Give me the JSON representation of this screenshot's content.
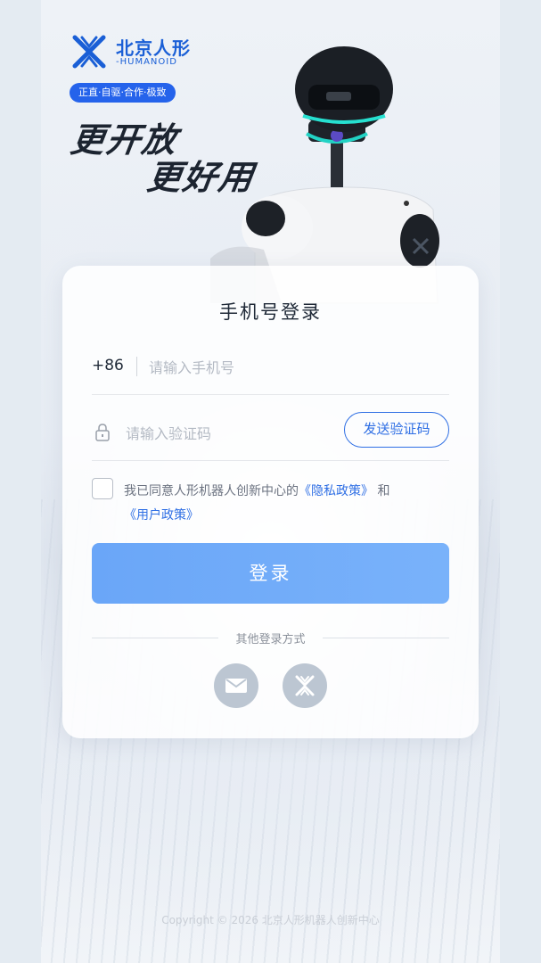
{
  "brand": {
    "name": "北京人形",
    "sub": "-HUMANOID",
    "slogan": "正直·自驱·合作·极致",
    "headline_line1": "更开放",
    "headline_line2": "更好用",
    "color": "#1a5fd6"
  },
  "login": {
    "title": "手机号登录",
    "country_code": "+86",
    "phone_placeholder": "请输入手机号",
    "code_placeholder": "请输入验证码",
    "send_code_label": "发送验证码",
    "agreement_prefix": "我已同意人形机器人创新中心的",
    "privacy_policy": "《隐私政策》",
    "agreement_and": "和",
    "user_policy": "《用户政策》",
    "agreement_checked": false,
    "login_button": "登录",
    "other_methods": "其他登录方式",
    "social_icons": [
      "mail-icon",
      "humanoid-logo-icon"
    ]
  },
  "footer": {
    "copyright": "Copyright © 2026 北京人形机器人创新中心"
  },
  "colors": {
    "accent": "#2f6fe4",
    "login_button": "#74adf9",
    "pill": "#2563eb"
  }
}
